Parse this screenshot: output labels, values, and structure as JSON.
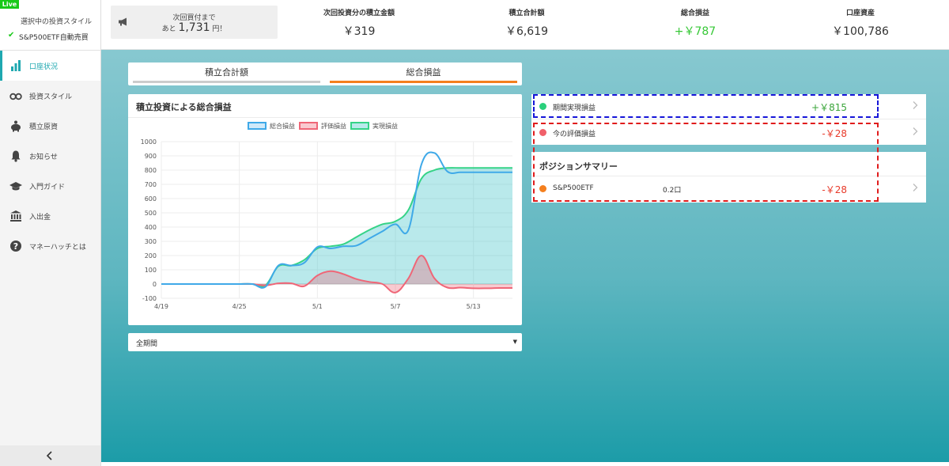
{
  "sidebar": {
    "live_badge": "Live",
    "style_title": "選択中の投資スタイル",
    "style_value": "S&P500ETF自動売買",
    "items": [
      {
        "label": "口座状況",
        "icon": "bar-chart-icon",
        "active": true
      },
      {
        "label": "投資スタイル",
        "icon": "binoculars-icon",
        "active": false
      },
      {
        "label": "積立原資",
        "icon": "piggy-bank-icon",
        "active": false
      },
      {
        "label": "お知らせ",
        "icon": "bell-icon",
        "active": false
      },
      {
        "label": "入門ガイド",
        "icon": "graduation-cap-icon",
        "active": false
      },
      {
        "label": "入出金",
        "icon": "bank-icon",
        "active": false
      },
      {
        "label": "マネーハッチとは",
        "icon": "question-circle-icon",
        "active": false
      }
    ],
    "collapse_icon": "chevron-left-icon"
  },
  "header": {
    "notice_line1": "次回買付まで",
    "notice_prefix": "あと",
    "notice_amount": "1,731",
    "notice_suffix": "円！",
    "notice_icon": "megaphone-icon",
    "metrics": [
      {
        "label": "次回投資分の積立金額",
        "value": "￥319"
      },
      {
        "label": "積立合計額",
        "value": "￥6,619"
      },
      {
        "label": "総合損益",
        "value": "+￥787",
        "color": "#37c837"
      },
      {
        "label": "口座資産",
        "value": "￥100,786"
      }
    ]
  },
  "tabs": [
    {
      "label": "積立合計額",
      "active": false
    },
    {
      "label": "総合損益",
      "active": true
    }
  ],
  "chart_title": "積立投資による総合損益",
  "period_select": {
    "value": "全期間"
  },
  "pl": {
    "realized": {
      "label": "期間実現損益",
      "value": "+￥815",
      "color": "#3aa53a",
      "dot_color": "#2ad07c"
    },
    "unrealized": {
      "label": "今の評価損益",
      "value": "-￥28",
      "color": "#e83a2a",
      "dot_color": "#f0606a"
    }
  },
  "summary": {
    "title": "ポジションサマリー",
    "positions": [
      {
        "name": "S&P500ETF",
        "qty": "0.2口",
        "value": "-￥28",
        "color": "#e83a2a",
        "dot_color": "#f47f1e"
      }
    ]
  },
  "chart_data": {
    "type": "line",
    "title": "",
    "xlabel": "",
    "ylabel": "",
    "ylim": [
      -100,
      1000
    ],
    "yticks": [
      -100,
      0,
      100,
      200,
      300,
      400,
      500,
      600,
      700,
      800,
      900,
      1000
    ],
    "xtick_labels": [
      "4/19",
      "4/25",
      "5/1",
      "5/7",
      "5/13"
    ],
    "xtick_day_index": [
      0,
      6,
      12,
      18,
      24
    ],
    "legend_position": "top-center",
    "grid": true,
    "series": [
      {
        "name": "総合損益",
        "color": "#3fa9e8",
        "fill": null,
        "x": [
          0,
          1,
          2,
          3,
          4,
          5,
          6,
          7,
          8,
          9,
          10,
          11,
          12,
          13,
          14,
          15,
          16,
          17,
          18,
          19,
          20,
          21,
          22,
          23,
          24,
          25,
          26,
          27
        ],
        "values": [
          0,
          0,
          0,
          0,
          0,
          0,
          0,
          0,
          -20,
          130,
          130,
          150,
          260,
          250,
          265,
          270,
          320,
          370,
          420,
          380,
          840,
          920,
          790,
          785,
          785,
          785,
          785,
          785
        ]
      },
      {
        "name": "評価損益",
        "color": "#ef6677",
        "fill": "rgba(239,102,119,0.35)",
        "x": [
          0,
          1,
          2,
          3,
          4,
          5,
          6,
          7,
          8,
          9,
          10,
          11,
          12,
          13,
          14,
          15,
          16,
          17,
          18,
          19,
          20,
          21,
          22,
          23,
          24,
          25,
          26,
          27
        ],
        "values": [
          0,
          0,
          0,
          0,
          0,
          0,
          0,
          0,
          -10,
          5,
          5,
          -15,
          60,
          90,
          70,
          35,
          15,
          0,
          -60,
          40,
          200,
          40,
          -25,
          -25,
          -30,
          -30,
          -28,
          -28
        ]
      },
      {
        "name": "実現損益",
        "color": "#35d387",
        "fill": "rgba(80,200,205,0.4)",
        "x": [
          0,
          1,
          2,
          3,
          4,
          5,
          6,
          7,
          8,
          9,
          10,
          11,
          12,
          13,
          14,
          15,
          16,
          17,
          18,
          19,
          20,
          21,
          22,
          23,
          24,
          25,
          26,
          27
        ],
        "values": [
          0,
          0,
          0,
          0,
          0,
          0,
          0,
          0,
          -10,
          125,
          130,
          170,
          250,
          265,
          280,
          330,
          380,
          420,
          440,
          520,
          740,
          800,
          815,
          815,
          815,
          815,
          815,
          815
        ]
      }
    ]
  }
}
